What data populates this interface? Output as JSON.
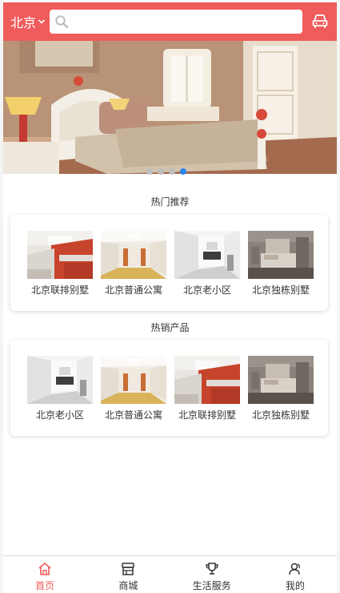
{
  "header": {
    "city": "北京",
    "search_placeholder": "",
    "accent_color": "#f05b5b"
  },
  "banner": {
    "slide_count": 4,
    "active_slide": 4
  },
  "hot_recommend": {
    "title": "热门推荐",
    "items": [
      {
        "label": "北京联排别墅",
        "image": "kitchen-red"
      },
      {
        "label": "北京普通公寓",
        "image": "room-yellow"
      },
      {
        "label": "北京老小区",
        "image": "room-white"
      },
      {
        "label": "北京独栋别墅",
        "image": "bedroom-dark"
      }
    ]
  },
  "hot_products": {
    "title": "热销产品",
    "items": [
      {
        "label": "北京老小区",
        "image": "room-white"
      },
      {
        "label": "北京普通公寓",
        "image": "room-yellow"
      },
      {
        "label": "北京联排别墅",
        "image": "kitchen-red"
      },
      {
        "label": "北京独栋别墅",
        "image": "bedroom-dark"
      }
    ]
  },
  "bottom_nav": [
    {
      "label": "首页",
      "icon": "home-icon",
      "active": true
    },
    {
      "label": "商城",
      "icon": "shop-icon",
      "active": false
    },
    {
      "label": "生活服务",
      "icon": "trophy-icon",
      "active": false
    },
    {
      "label": "我的",
      "icon": "user-icon",
      "active": false
    }
  ]
}
